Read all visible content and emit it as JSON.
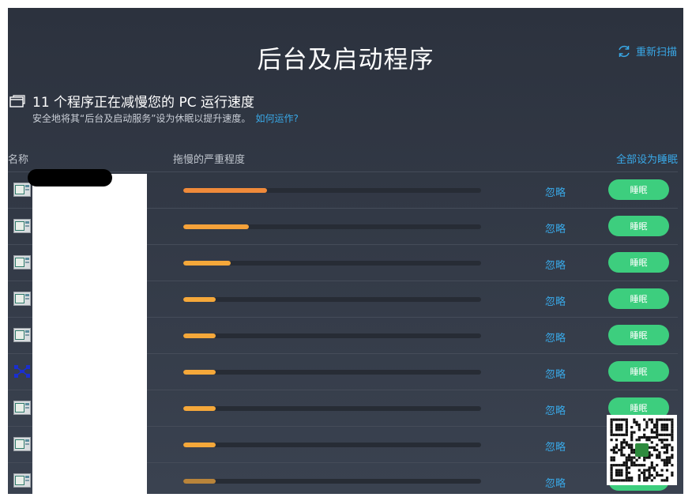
{
  "header": {
    "title": "后台及启动程序",
    "rescan_label": "重新扫描"
  },
  "summary": {
    "headline": "11 个程序正在减慢您的 PC 运行速度",
    "description": "安全地将其“后台及启动服务”设为休眠以提升速度。",
    "help_link": "如何运作?"
  },
  "table": {
    "col_name": "名称",
    "col_severity": "拖慢的严重程度",
    "sleep_all_label": "全部设为睡眠",
    "rows": [
      {
        "icon": "app-window-icon",
        "severity": 0.28,
        "color": "#f08a3a",
        "ignore": "忽略",
        "action": "睡眠"
      },
      {
        "icon": "app-window-icon",
        "severity": 0.22,
        "color": "#f5a23a",
        "ignore": "忽略",
        "action": "睡眠"
      },
      {
        "icon": "app-window-icon",
        "severity": 0.16,
        "color": "#f5a83a",
        "ignore": "忽略",
        "action": "睡眠"
      },
      {
        "icon": "app-window-icon",
        "severity": 0.11,
        "color": "#f5a83a",
        "ignore": "忽略",
        "action": "睡眠"
      },
      {
        "icon": "app-window-icon",
        "severity": 0.11,
        "color": "#f5a83a",
        "ignore": "忽略",
        "action": "睡眠"
      },
      {
        "icon": "blue-network-icon",
        "severity": 0.11,
        "color": "#f5a83a",
        "ignore": "忽略",
        "action": "睡眠"
      },
      {
        "icon": "app-window-icon",
        "severity": 0.11,
        "color": "#f5a83a",
        "ignore": "忽略",
        "action": "睡眠"
      },
      {
        "icon": "app-window-icon",
        "severity": 0.11,
        "color": "#f5a83a",
        "ignore": "忽略",
        "action": "睡眠"
      },
      {
        "icon": "app-window-icon",
        "severity": 0.11,
        "color": "#b9843a",
        "ignore": "忽略",
        "action": "睡眠"
      }
    ]
  },
  "colors": {
    "accent": "#39a9e8",
    "sleep_button": "#3dce7e",
    "background": "#2c323e"
  }
}
